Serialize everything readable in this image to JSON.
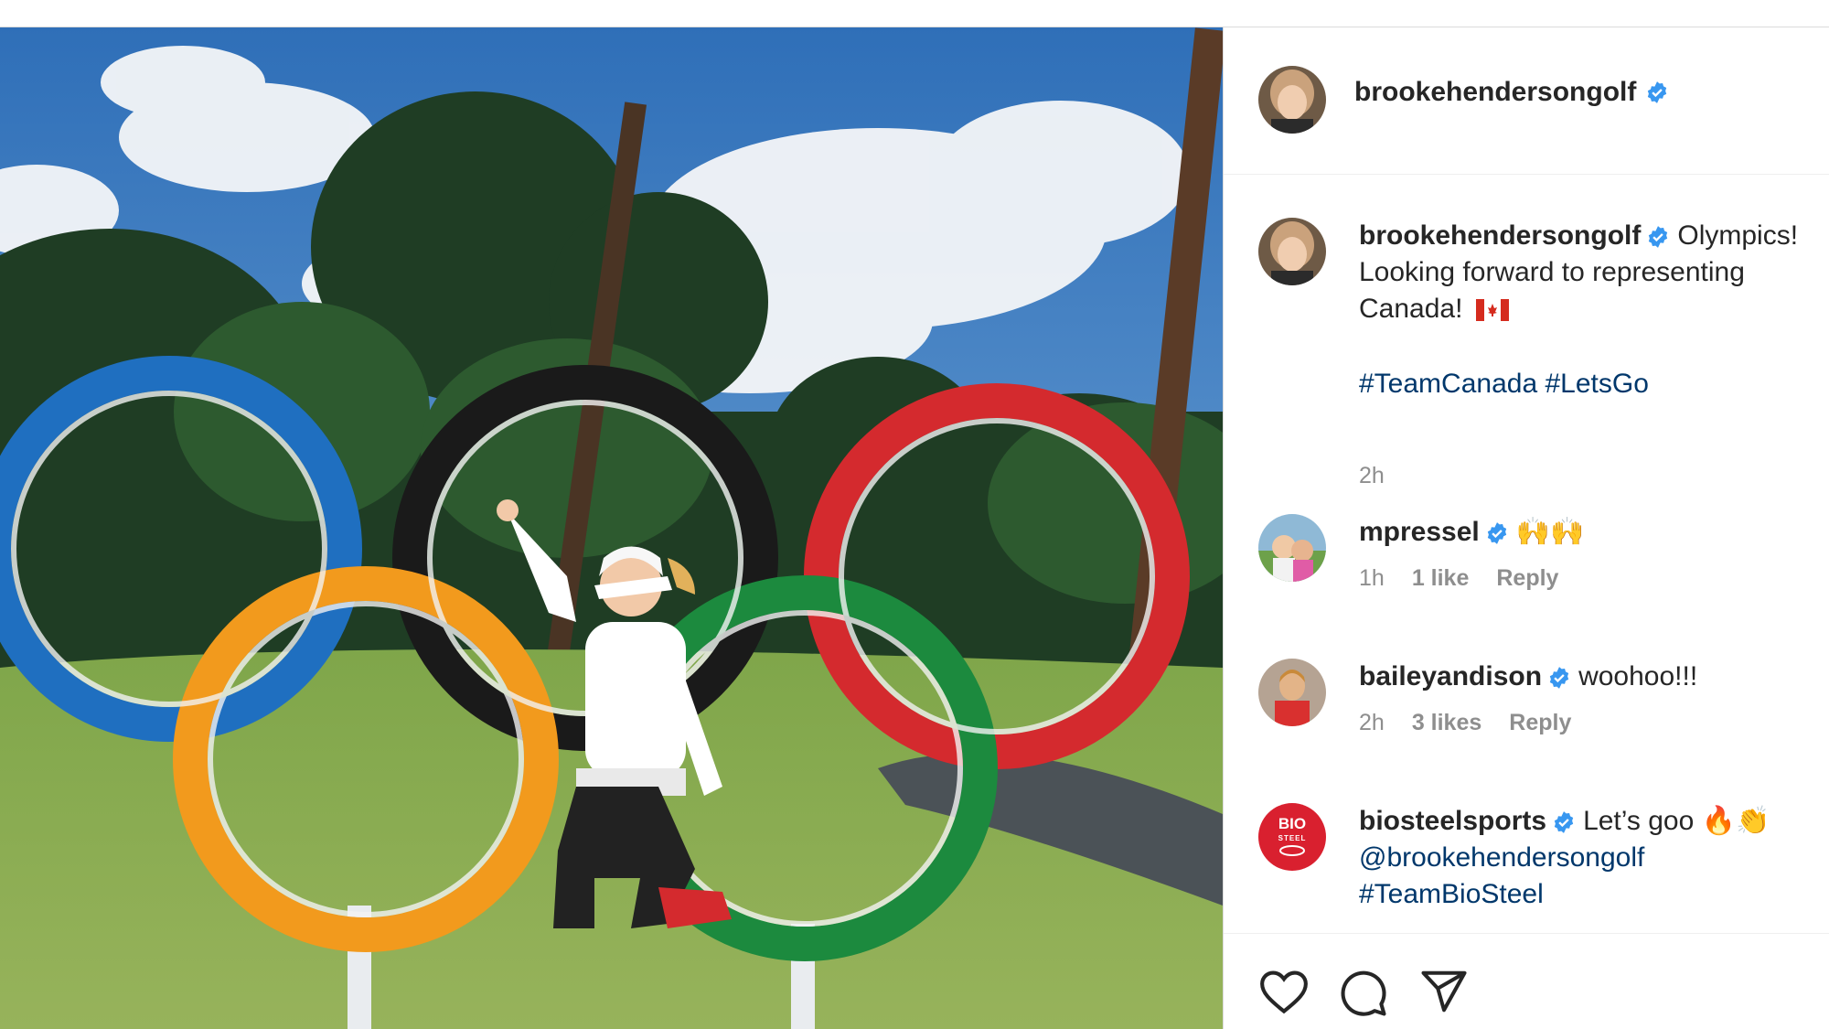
{
  "post": {
    "username": "brookehendersongolf",
    "caption_username": "brookehendersongolf",
    "caption_text": "Olympics! Looking forward to representing Canada!",
    "caption_flag": "canada-flag-emoji",
    "hashtags": "#TeamCanada #LetsGo",
    "time": "2h"
  },
  "comments": [
    {
      "username": "mpressel",
      "text": "🙌🙌",
      "time": "1h",
      "likes": "1 like",
      "reply": "Reply"
    },
    {
      "username": "baileyandison",
      "text": "woohoo!!!",
      "time": "2h",
      "likes": "3 likes",
      "reply": "Reply"
    },
    {
      "username": "biosteelsports",
      "text": "Let’s goo 🔥👏",
      "mention": "@brookehendersongolf",
      "hashtag": "#TeamBioSteel",
      "avatar_text_top": "BIO",
      "avatar_text_bottom": "STEEL"
    }
  ],
  "colors": {
    "verified": "#3897f0",
    "text": "#262626",
    "secondary": "#8e8e8e",
    "link": "#00376b",
    "biosteel_red": "#d9202f"
  },
  "icons": [
    "heart-icon",
    "comment-icon",
    "share-icon",
    "verified-badge-icon"
  ]
}
